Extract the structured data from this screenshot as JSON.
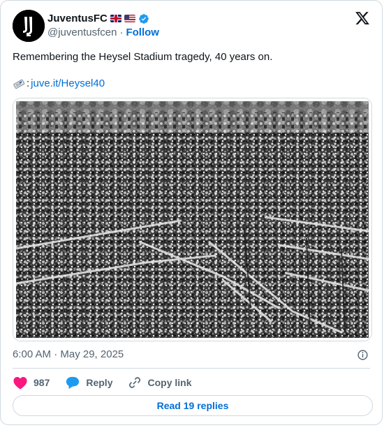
{
  "author": {
    "display_name": "JuventusFC",
    "handle": "@juventusfcen",
    "separator": "·",
    "follow_label": "Follow",
    "flags": [
      "uk-flag",
      "us-flag"
    ],
    "verified_color": "#1d9bf0"
  },
  "tweet": {
    "text": "Remembering the Heysel Stadium tragedy, 40 years on.",
    "link_prefix": ":",
    "link_text": "juve.it/Heysel40",
    "image_description_icon": "newspaper-icon"
  },
  "meta": {
    "timestamp": "6:00 AM · May 29, 2025"
  },
  "actions": {
    "like_count": "987",
    "reply_label": "Reply",
    "copy_link_label": "Copy link",
    "read_replies_label": "Read 19 replies"
  },
  "colors": {
    "link": "#006fd6",
    "like": "#f91880",
    "reply": "#1d9bf0",
    "secondary_text": "#536471",
    "border": "#cfd9de"
  }
}
